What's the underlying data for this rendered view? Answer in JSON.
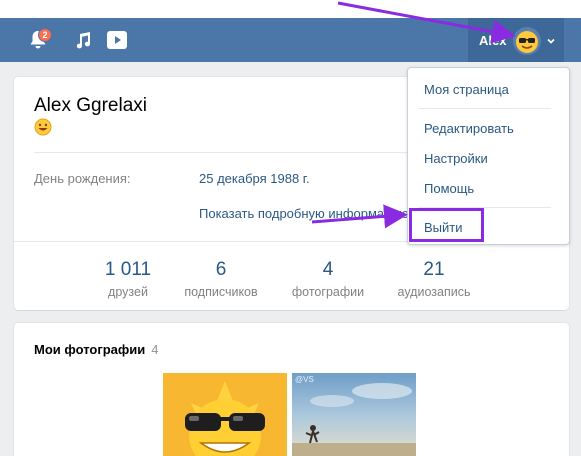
{
  "header": {
    "notifications_count": "2",
    "username": "Alex",
    "icons": [
      "bell-icon",
      "music-icon",
      "video-icon",
      "chevron-down-icon"
    ]
  },
  "profile": {
    "name": "Alex Ggrelaxi",
    "birthday_label": "День рождения:",
    "birthday_value": "25 декабря 1988 г.",
    "more_info_link": "Показать подробную информацию"
  },
  "counters": [
    {
      "value": "1 011",
      "label": "друзей"
    },
    {
      "value": "6",
      "label": "подписчиков"
    },
    {
      "value": "4",
      "label": "фотографии"
    },
    {
      "value": "21",
      "label": "аудиозапись"
    }
  ],
  "photos": {
    "title": "Мои фотографии",
    "count": "4",
    "watermark": "@VS"
  },
  "menu": {
    "my_page": "Моя страница",
    "edit": "Редактировать",
    "settings": "Настройки",
    "help": "Помощь",
    "logout": "Выйти"
  },
  "colors": {
    "header": "#4a76a8",
    "link": "#2a5885",
    "annotation": "#8a2be2",
    "badge": "#ff6c4f"
  }
}
